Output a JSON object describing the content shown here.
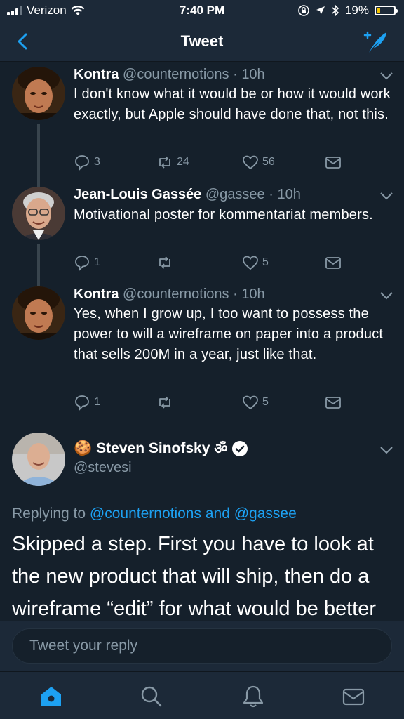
{
  "status_bar": {
    "carrier": "Verizon",
    "time": "7:40 PM",
    "battery_percent": "19%",
    "battery_level": 0.19,
    "battery_color": "#f5c400"
  },
  "nav": {
    "title": "Tweet",
    "back_icon": "chevron-left-icon",
    "compose_icon": "compose-tweet-icon"
  },
  "colors": {
    "background": "#15202b",
    "bar": "#1c2938",
    "accent": "#1da1f2",
    "secondary_text": "#8899a6"
  },
  "thread": [
    {
      "name": "Kontra",
      "handle": "@counternotions",
      "time": "10h",
      "text": "I don't know what it would be or how it would work exactly, but Apple should have done that, not this.",
      "replies": "3",
      "retweets": "24",
      "likes": "56"
    },
    {
      "name": "Jean-Louis Gassée",
      "handle": "@gassee",
      "time": "10h",
      "text": "Motivational poster for kommentariat members.",
      "replies": "1",
      "retweets": "",
      "likes": "5"
    },
    {
      "name": "Kontra",
      "handle": "@counternotions",
      "time": "10h",
      "text": "Yes, when I grow up, I too want to possess the power to will a wireframe on paper into a product that sells 200M in a year, just like that.",
      "replies": "1",
      "retweets": "",
      "likes": "5"
    }
  ],
  "main_tweet": {
    "name_emoji": "🍪",
    "name": "Steven Sinofsky",
    "name_suffix": "ॐ",
    "handle": "@stevesi",
    "replying_prefix": "Replying to",
    "replying_to_1": "@counternotions",
    "replying_and": "and",
    "replying_to_2": "@gassee",
    "text": "Skipped a step. First you have to look at the new product that will ship, then do a wireframe “edit” for what would be better"
  },
  "reply": {
    "placeholder": "Tweet your reply"
  },
  "tab_bar": {
    "items": [
      "home-icon",
      "search-icon",
      "notifications-icon",
      "messages-icon"
    ],
    "active": "home-icon"
  }
}
